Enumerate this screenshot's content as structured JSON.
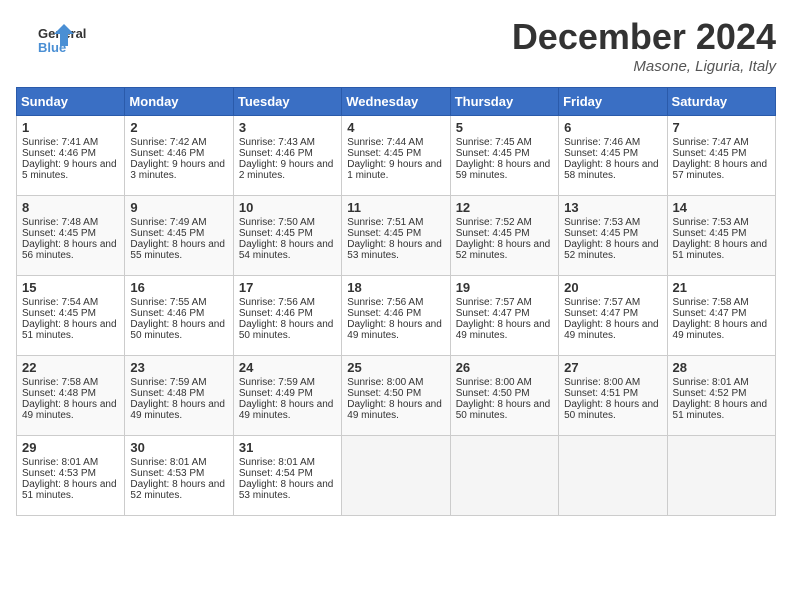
{
  "header": {
    "logo_line1": "General",
    "logo_line2": "Blue",
    "month": "December 2024",
    "location": "Masone, Liguria, Italy"
  },
  "weekdays": [
    "Sunday",
    "Monday",
    "Tuesday",
    "Wednesday",
    "Thursday",
    "Friday",
    "Saturday"
  ],
  "weeks": [
    [
      {
        "day": "1",
        "sunrise": "Sunrise: 7:41 AM",
        "sunset": "Sunset: 4:46 PM",
        "daylight": "Daylight: 9 hours and 5 minutes."
      },
      {
        "day": "2",
        "sunrise": "Sunrise: 7:42 AM",
        "sunset": "Sunset: 4:46 PM",
        "daylight": "Daylight: 9 hours and 3 minutes."
      },
      {
        "day": "3",
        "sunrise": "Sunrise: 7:43 AM",
        "sunset": "Sunset: 4:46 PM",
        "daylight": "Daylight: 9 hours and 2 minutes."
      },
      {
        "day": "4",
        "sunrise": "Sunrise: 7:44 AM",
        "sunset": "Sunset: 4:45 PM",
        "daylight": "Daylight: 9 hours and 1 minute."
      },
      {
        "day": "5",
        "sunrise": "Sunrise: 7:45 AM",
        "sunset": "Sunset: 4:45 PM",
        "daylight": "Daylight: 8 hours and 59 minutes."
      },
      {
        "day": "6",
        "sunrise": "Sunrise: 7:46 AM",
        "sunset": "Sunset: 4:45 PM",
        "daylight": "Daylight: 8 hours and 58 minutes."
      },
      {
        "day": "7",
        "sunrise": "Sunrise: 7:47 AM",
        "sunset": "Sunset: 4:45 PM",
        "daylight": "Daylight: 8 hours and 57 minutes."
      }
    ],
    [
      {
        "day": "8",
        "sunrise": "Sunrise: 7:48 AM",
        "sunset": "Sunset: 4:45 PM",
        "daylight": "Daylight: 8 hours and 56 minutes."
      },
      {
        "day": "9",
        "sunrise": "Sunrise: 7:49 AM",
        "sunset": "Sunset: 4:45 PM",
        "daylight": "Daylight: 8 hours and 55 minutes."
      },
      {
        "day": "10",
        "sunrise": "Sunrise: 7:50 AM",
        "sunset": "Sunset: 4:45 PM",
        "daylight": "Daylight: 8 hours and 54 minutes."
      },
      {
        "day": "11",
        "sunrise": "Sunrise: 7:51 AM",
        "sunset": "Sunset: 4:45 PM",
        "daylight": "Daylight: 8 hours and 53 minutes."
      },
      {
        "day": "12",
        "sunrise": "Sunrise: 7:52 AM",
        "sunset": "Sunset: 4:45 PM",
        "daylight": "Daylight: 8 hours and 52 minutes."
      },
      {
        "day": "13",
        "sunrise": "Sunrise: 7:53 AM",
        "sunset": "Sunset: 4:45 PM",
        "daylight": "Daylight: 8 hours and 52 minutes."
      },
      {
        "day": "14",
        "sunrise": "Sunrise: 7:53 AM",
        "sunset": "Sunset: 4:45 PM",
        "daylight": "Daylight: 8 hours and 51 minutes."
      }
    ],
    [
      {
        "day": "15",
        "sunrise": "Sunrise: 7:54 AM",
        "sunset": "Sunset: 4:45 PM",
        "daylight": "Daylight: 8 hours and 51 minutes."
      },
      {
        "day": "16",
        "sunrise": "Sunrise: 7:55 AM",
        "sunset": "Sunset: 4:46 PM",
        "daylight": "Daylight: 8 hours and 50 minutes."
      },
      {
        "day": "17",
        "sunrise": "Sunrise: 7:56 AM",
        "sunset": "Sunset: 4:46 PM",
        "daylight": "Daylight: 8 hours and 50 minutes."
      },
      {
        "day": "18",
        "sunrise": "Sunrise: 7:56 AM",
        "sunset": "Sunset: 4:46 PM",
        "daylight": "Daylight: 8 hours and 49 minutes."
      },
      {
        "day": "19",
        "sunrise": "Sunrise: 7:57 AM",
        "sunset": "Sunset: 4:47 PM",
        "daylight": "Daylight: 8 hours and 49 minutes."
      },
      {
        "day": "20",
        "sunrise": "Sunrise: 7:57 AM",
        "sunset": "Sunset: 4:47 PM",
        "daylight": "Daylight: 8 hours and 49 minutes."
      },
      {
        "day": "21",
        "sunrise": "Sunrise: 7:58 AM",
        "sunset": "Sunset: 4:47 PM",
        "daylight": "Daylight: 8 hours and 49 minutes."
      }
    ],
    [
      {
        "day": "22",
        "sunrise": "Sunrise: 7:58 AM",
        "sunset": "Sunset: 4:48 PM",
        "daylight": "Daylight: 8 hours and 49 minutes."
      },
      {
        "day": "23",
        "sunrise": "Sunrise: 7:59 AM",
        "sunset": "Sunset: 4:48 PM",
        "daylight": "Daylight: 8 hours and 49 minutes."
      },
      {
        "day": "24",
        "sunrise": "Sunrise: 7:59 AM",
        "sunset": "Sunset: 4:49 PM",
        "daylight": "Daylight: 8 hours and 49 minutes."
      },
      {
        "day": "25",
        "sunrise": "Sunrise: 8:00 AM",
        "sunset": "Sunset: 4:50 PM",
        "daylight": "Daylight: 8 hours and 49 minutes."
      },
      {
        "day": "26",
        "sunrise": "Sunrise: 8:00 AM",
        "sunset": "Sunset: 4:50 PM",
        "daylight": "Daylight: 8 hours and 50 minutes."
      },
      {
        "day": "27",
        "sunrise": "Sunrise: 8:00 AM",
        "sunset": "Sunset: 4:51 PM",
        "daylight": "Daylight: 8 hours and 50 minutes."
      },
      {
        "day": "28",
        "sunrise": "Sunrise: 8:01 AM",
        "sunset": "Sunset: 4:52 PM",
        "daylight": "Daylight: 8 hours and 51 minutes."
      }
    ],
    [
      {
        "day": "29",
        "sunrise": "Sunrise: 8:01 AM",
        "sunset": "Sunset: 4:53 PM",
        "daylight": "Daylight: 8 hours and 51 minutes."
      },
      {
        "day": "30",
        "sunrise": "Sunrise: 8:01 AM",
        "sunset": "Sunset: 4:53 PM",
        "daylight": "Daylight: 8 hours and 52 minutes."
      },
      {
        "day": "31",
        "sunrise": "Sunrise: 8:01 AM",
        "sunset": "Sunset: 4:54 PM",
        "daylight": "Daylight: 8 hours and 53 minutes."
      },
      null,
      null,
      null,
      null
    ]
  ]
}
